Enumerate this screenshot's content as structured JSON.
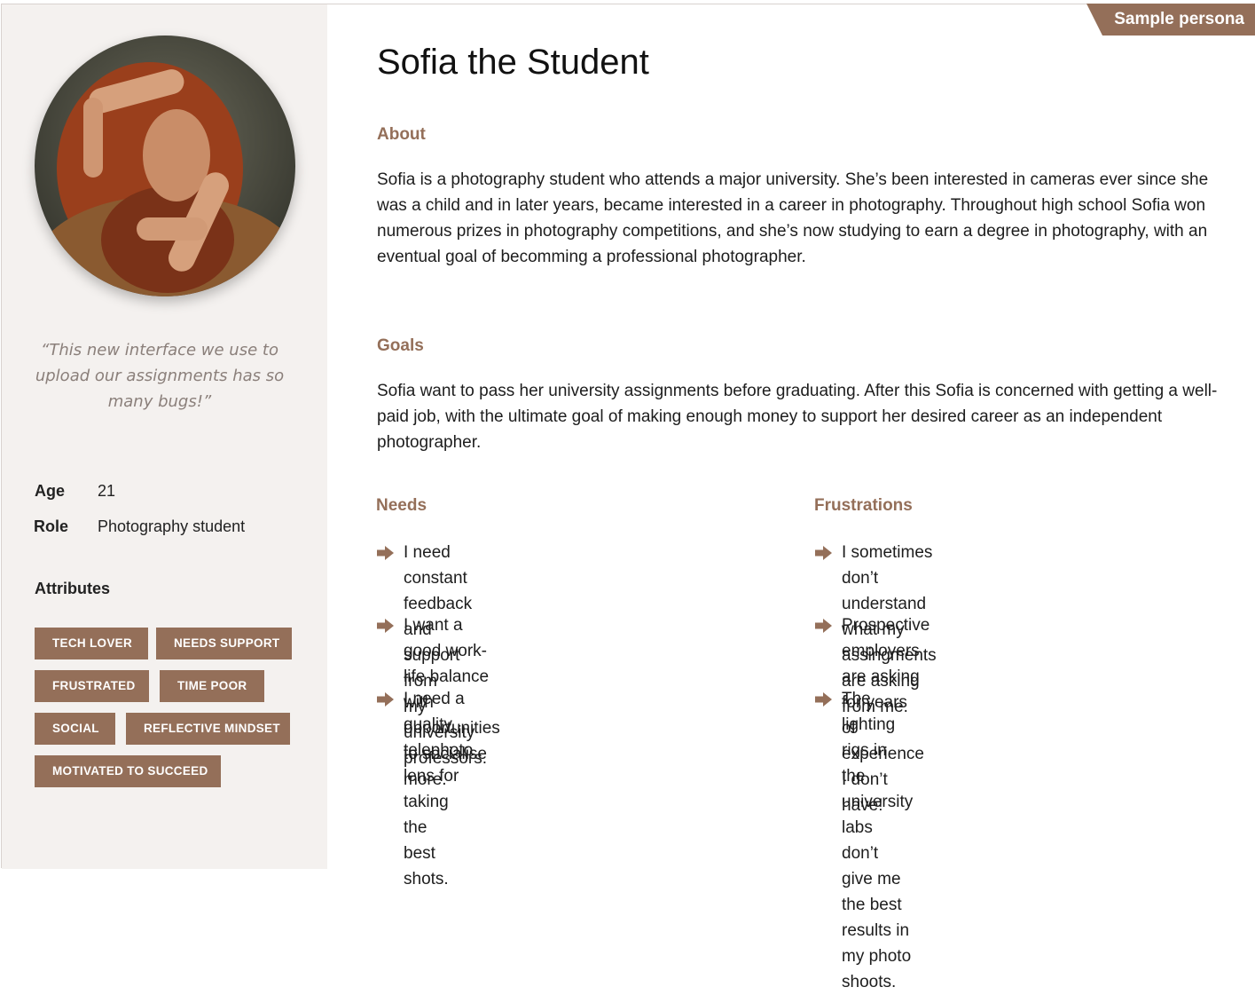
{
  "badge": "Sample persona",
  "persona": {
    "name": "Sofia the Student",
    "quote": "“This new interface we use to upload our assignments has so many bugs!”",
    "age_label": "Age",
    "age_value": "21",
    "role_label": "Role",
    "role_value": "Photography student",
    "attributes_title": "Attributes",
    "attributes": [
      "TECH LOVER",
      "NEEDS SUPPORT",
      "FRUSTRATED",
      "TIME POOR",
      "SOCIAL",
      "REFLECTIVE MINDSET",
      "MOTIVATED TO SUCCEED"
    ]
  },
  "about": {
    "heading": "About",
    "text": "Sofia is a photography student who attends a major university. She’s been interested in cameras ever since she was a child and in later years, became interested in a career in photography. Throughout high school Sofia won numerous prizes in photography competitions, and she’s now studying to earn a degree in photography, with an eventual goal of becomming a professional photographer."
  },
  "goals": {
    "heading": "Goals",
    "text": "Sofia want to pass her university assignments before graduating. After this Sofia is concerned with getting a well-paid job, with the ultimate goal of making enough money to support her desired career as an independent photographer."
  },
  "needs": {
    "heading": "Needs",
    "items": [
      {
        "line1": "I need constant feedback and support from",
        "line2": "my university professors."
      },
      {
        "line1": "I want a good work-life balance with",
        "line2": "opportunities to socialise more."
      },
      {
        "line1": "I need a quality telephoto lens for taking the",
        "line2": "best shots."
      }
    ]
  },
  "frustrations": {
    "heading": "Frustrations",
    "items": [
      {
        "line1": "I sometimes don’t understand what my",
        "line2": "assingments are asking from me."
      },
      {
        "line1": "Prospective employers are asking for years",
        "line2": "of experience I don’t have!"
      },
      {
        "line1": "The lighting rigs in the university labs don’t",
        "line2": "give me the best results in my photo shoots."
      }
    ]
  },
  "colors": {
    "accent": "#946f59",
    "sidebar_bg": "#f4f1ef",
    "quote_text": "#8a7f7a"
  },
  "icons": {
    "list_bullet": "arrow-right-icon"
  }
}
